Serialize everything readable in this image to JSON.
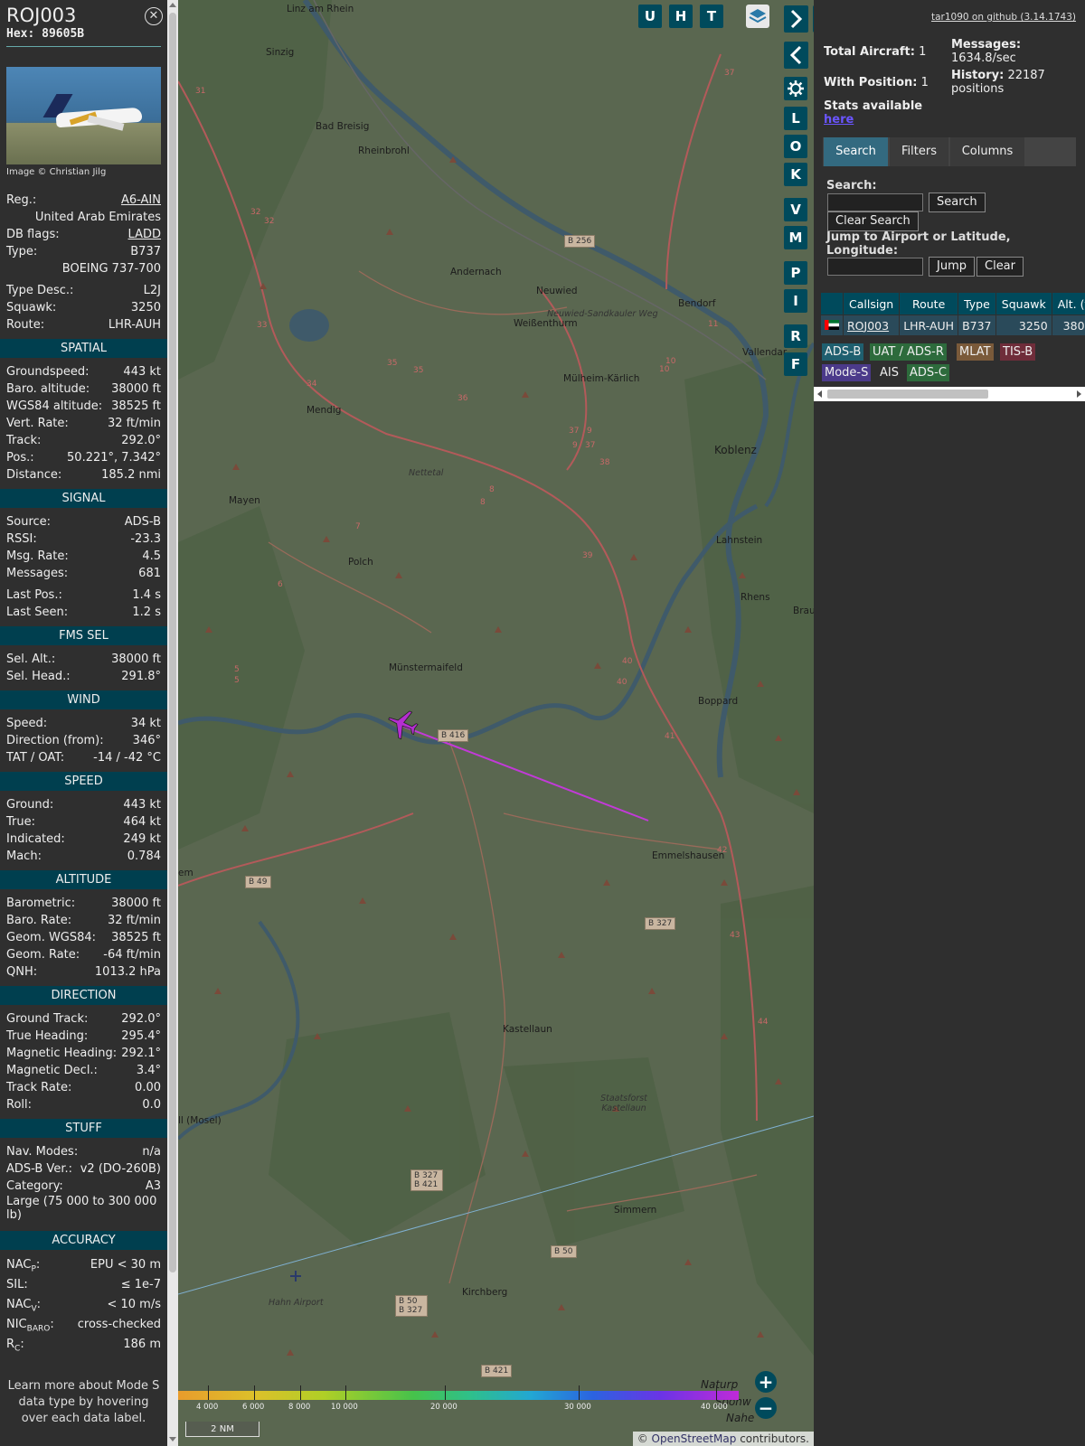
{
  "sidebar": {
    "callsign": "ROJ003",
    "hex_label": "Hex:",
    "hex": "89605B",
    "photo_credit": "Image © Christian Jilg",
    "reg_label": "Reg.:",
    "reg": "A6-AIN",
    "country": "United Arab Emirates",
    "dbflags_label": "DB flags:",
    "dbflags": "LADD",
    "type_label": "Type:",
    "type": "B737",
    "type_full": "BOEING 737-700",
    "typedesc_label": "Type Desc.:",
    "typedesc": "L2J",
    "squawk_label": "Squawk:",
    "squawk": "3250",
    "route_label": "Route:",
    "route": "LHR-AUH",
    "sections": {
      "spatial": "SPATIAL",
      "signal": "SIGNAL",
      "fms": "FMS SEL",
      "wind": "WIND",
      "speed": "SPEED",
      "altitude": "ALTITUDE",
      "direction": "DIRECTION",
      "stuff": "STUFF",
      "accuracy": "ACCURACY"
    },
    "spatial": [
      {
        "label": "Groundspeed:",
        "value": "443 kt"
      },
      {
        "label": "Baro. altitude:",
        "value": "38000 ft"
      },
      {
        "label": "WGS84 altitude:",
        "value": "38525 ft"
      },
      {
        "label": "Vert. Rate:",
        "value": "32 ft/min"
      },
      {
        "label": "Track:",
        "value": "292.0°"
      },
      {
        "label": "Pos.:",
        "value": "50.221°, 7.342°"
      },
      {
        "label": "Distance:",
        "value": "185.2 nmi"
      }
    ],
    "signal": [
      {
        "label": "Source:",
        "value": "ADS-B"
      },
      {
        "label": "RSSI:",
        "value": "-23.3"
      },
      {
        "label": "Msg. Rate:",
        "value": "4.5"
      },
      {
        "label": "Messages:",
        "value": "681"
      },
      {
        "label": "Last Pos.:",
        "value": "1.4 s"
      },
      {
        "label": "Last Seen:",
        "value": "1.2 s"
      }
    ],
    "fms": [
      {
        "label": "Sel. Alt.:",
        "value": "38000 ft"
      },
      {
        "label": "Sel. Head.:",
        "value": "291.8°"
      }
    ],
    "wind": [
      {
        "label": "Speed:",
        "value": "34 kt"
      },
      {
        "label": "Direction (from):",
        "value": "346°"
      },
      {
        "label": "TAT / OAT:",
        "value": "-14 / -42 °C"
      }
    ],
    "speed": [
      {
        "label": "Ground:",
        "value": "443 kt"
      },
      {
        "label": "True:",
        "value": "464 kt"
      },
      {
        "label": "Indicated:",
        "value": "249 kt"
      },
      {
        "label": "Mach:",
        "value": "0.784"
      }
    ],
    "altitude": [
      {
        "label": "Barometric:",
        "value": "38000 ft"
      },
      {
        "label": "Baro. Rate:",
        "value": "32 ft/min"
      },
      {
        "label": "Geom. WGS84:",
        "value": "38525 ft"
      },
      {
        "label": "Geom. Rate:",
        "value": "-64 ft/min"
      },
      {
        "label": "QNH:",
        "value": "1013.2 hPa"
      }
    ],
    "direction": [
      {
        "label": "Ground Track:",
        "value": "292.0°"
      },
      {
        "label": "True Heading:",
        "value": "295.4°"
      },
      {
        "label": "Magnetic Heading:",
        "value": "292.1°"
      },
      {
        "label": "Magnetic Decl.:",
        "value": "3.4°"
      },
      {
        "label": "Track Rate:",
        "value": "0.00"
      },
      {
        "label": "Roll:",
        "value": "0.0"
      }
    ],
    "stuff": [
      {
        "label": "Nav. Modes:",
        "value": "n/a"
      },
      {
        "label": "ADS-B Ver.:",
        "value": "v2 (DO-260B)"
      },
      {
        "label": "Category:",
        "value": "A3"
      }
    ],
    "category_desc": "Large (75 000 to 300 000 lb)",
    "accuracy": {
      "nacp_label": "NAC",
      "nacp_sub": "P",
      "nacp_value": "EPU < 30 m",
      "sil_label": "SIL:",
      "sil_value": "≤ 1e-7",
      "nacv_label": "NAC",
      "nacv_sub": "V",
      "nacv_value": "< 10 m/s",
      "nicbaro_label": "NIC",
      "nicbaro_sub": "BARO",
      "nicbaro_value": "cross-checked",
      "rc_label": "R",
      "rc_sub": "C",
      "rc_value": "186 m"
    },
    "learn_more": "Learn more about Mode S data type by hovering over each data label."
  },
  "map": {
    "buttons_top": [
      "U",
      "H",
      "T"
    ],
    "side_buttons": [
      "L",
      "O",
      "K",
      "V",
      "M",
      "P",
      "I",
      "R",
      "F"
    ],
    "places": [
      "Linz am Rhein",
      "Sinzig",
      "Bad Breisig",
      "Rheinbrohl",
      "Andernach",
      "Neuwied",
      "Bendorf",
      "Weißenthurm",
      "Vallendar",
      "Mülheim-Kärlich",
      "Mendig",
      "Koblenz",
      "Mayen",
      "Lahnstein",
      "Polch",
      "Rhens",
      "Brau",
      "Münstermaifeld",
      "Boppard",
      "Emmelshausen",
      "Kastellaun",
      "Simmern",
      "Kirchberg",
      "Hahn Airport",
      "em",
      "ll (Mosel)",
      "Naturp",
      "Soonw",
      "Nahe"
    ],
    "italic_places": [
      "Nettetal",
      "Neuwied-Sandkauler Weg",
      "Staatsforst Kastellaun"
    ],
    "road_labels": [
      "B 256",
      "B 416",
      "B 49",
      "B 327",
      "B 327 B 421",
      "B 50",
      "B 50 B 327",
      "B 421"
    ],
    "road_numbers": [
      "37",
      "31",
      "32",
      "32",
      "33",
      "34",
      "35",
      "35",
      "36",
      "37",
      "9",
      "9",
      "37",
      "38",
      "8",
      "8",
      "7",
      "6",
      "5",
      "5",
      "39",
      "40",
      "40",
      "41",
      "42",
      "43",
      "44",
      "10",
      "10",
      "11"
    ],
    "colorbar_labels": [
      "4 000",
      "6 000",
      "8 000",
      "10 000",
      "20 000",
      "30 000",
      "40 000"
    ],
    "scale": "2 NM",
    "attribution_prefix": "© ",
    "attribution_link": "OpenStreetMap",
    "attribution_suffix": " contributors.",
    "zoom_in": "+",
    "zoom_out": "−"
  },
  "panel": {
    "github": "tar1090 on github (3.14.1743)",
    "total_aircraft_label": "Total Aircraft:",
    "total_aircraft": "1",
    "with_position_label": "With Position:",
    "with_position": "1",
    "messages_label": "Messages:",
    "messages": "1634.8/sec",
    "history_label": "History:",
    "history": "22187 positions",
    "stats_label": "Stats available",
    "stats_link": "here",
    "tabs": [
      "Search",
      "Filters",
      "Columns"
    ],
    "search_label": "Search:",
    "search_button": "Search",
    "clear_search_button": "Clear Search",
    "jump_label": "Jump to Airport or Latitude, Longitude:",
    "jump_button": "Jump",
    "clear_button": "Clear",
    "table": {
      "headers": [
        "Callsign",
        "Route",
        "Type",
        "Squawk",
        "Alt. (ft)",
        "S"
      ],
      "rows": [
        {
          "callsign": "ROJ003",
          "route": "LHR-AUH",
          "type": "B737",
          "squawk": "3250",
          "alt": "38000"
        }
      ]
    },
    "legend": [
      "ADS-B",
      "UAT / ADS-R",
      "MLAT",
      "TIS-B",
      "Mode-S",
      "AIS",
      "ADS-C"
    ],
    "legend_colors": [
      "#1f5f6f",
      "#2d6b3c",
      "#7a5a3a",
      "#6f2d3a",
      "#4b3a8a",
      "#2f2f2f",
      "#2d6b3c"
    ]
  }
}
